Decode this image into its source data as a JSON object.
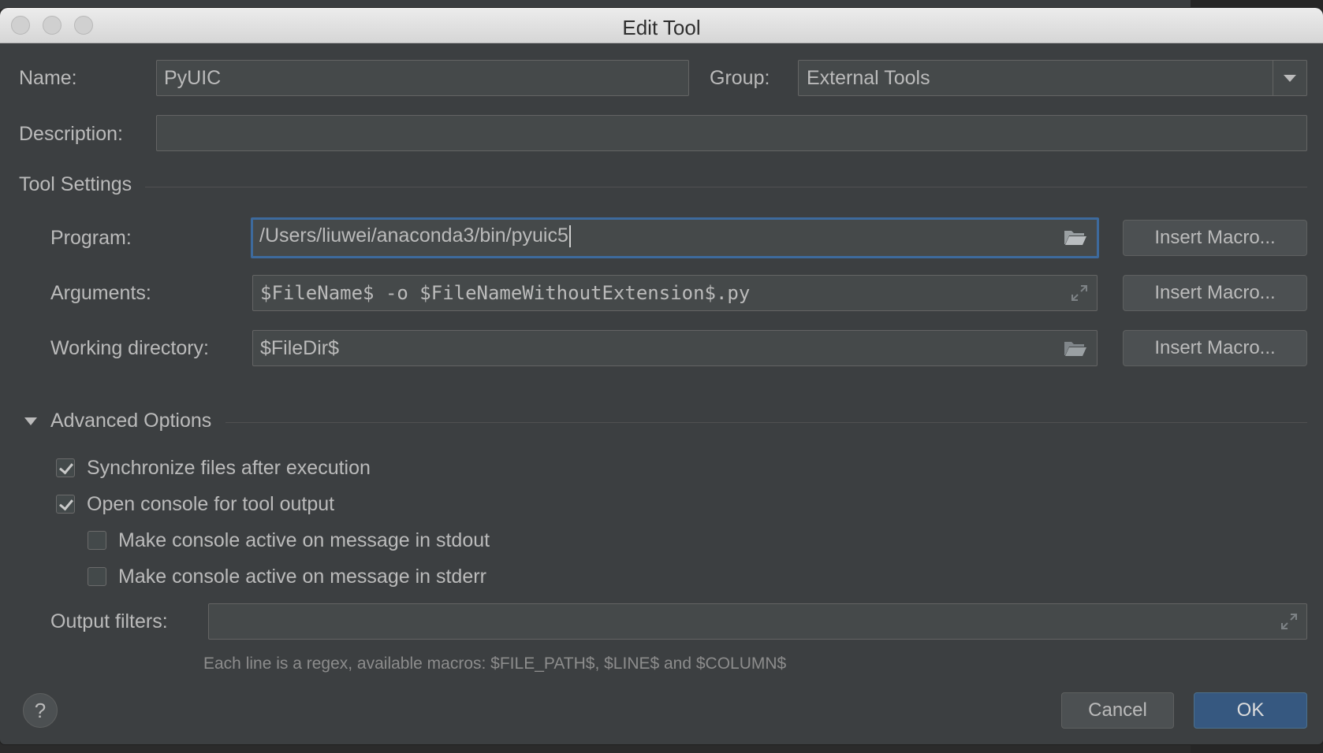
{
  "window": {
    "title": "Edit Tool"
  },
  "name": {
    "label": "Name:",
    "value": "PyUIC"
  },
  "group": {
    "label": "Group:",
    "value": "External Tools"
  },
  "description": {
    "label": "Description:",
    "value": ""
  },
  "tool_settings": {
    "title": "Tool Settings",
    "program": {
      "label": "Program:",
      "value": "/Users/liuwei/anaconda3/bin/pyuic5",
      "macro_label": "Insert Macro..."
    },
    "arguments": {
      "label": "Arguments:",
      "value": "$FileName$ -o $FileNameWithoutExtension$.py",
      "macro_label": "Insert Macro..."
    },
    "working_directory": {
      "label": "Working directory:",
      "value": "$FileDir$",
      "macro_label": "Insert Macro..."
    }
  },
  "advanced": {
    "title": "Advanced Options",
    "options": [
      {
        "label": "Synchronize files after execution",
        "checked": true
      },
      {
        "label": "Open console for tool output",
        "checked": true
      },
      {
        "label": "Make console active on message in stdout",
        "checked": false
      },
      {
        "label": "Make console active on message in stderr",
        "checked": false
      }
    ],
    "output_filters": {
      "label": "Output filters:",
      "value": "",
      "hint": "Each line is a regex, available macros: $FILE_PATH$, $LINE$ and $COLUMN$"
    }
  },
  "footer": {
    "help": "?",
    "cancel": "Cancel",
    "ok": "OK"
  },
  "colors": {
    "background": "#3c3f41",
    "field": "#45494a",
    "focus": "#3d6a9d",
    "primary_button": "#365880"
  }
}
